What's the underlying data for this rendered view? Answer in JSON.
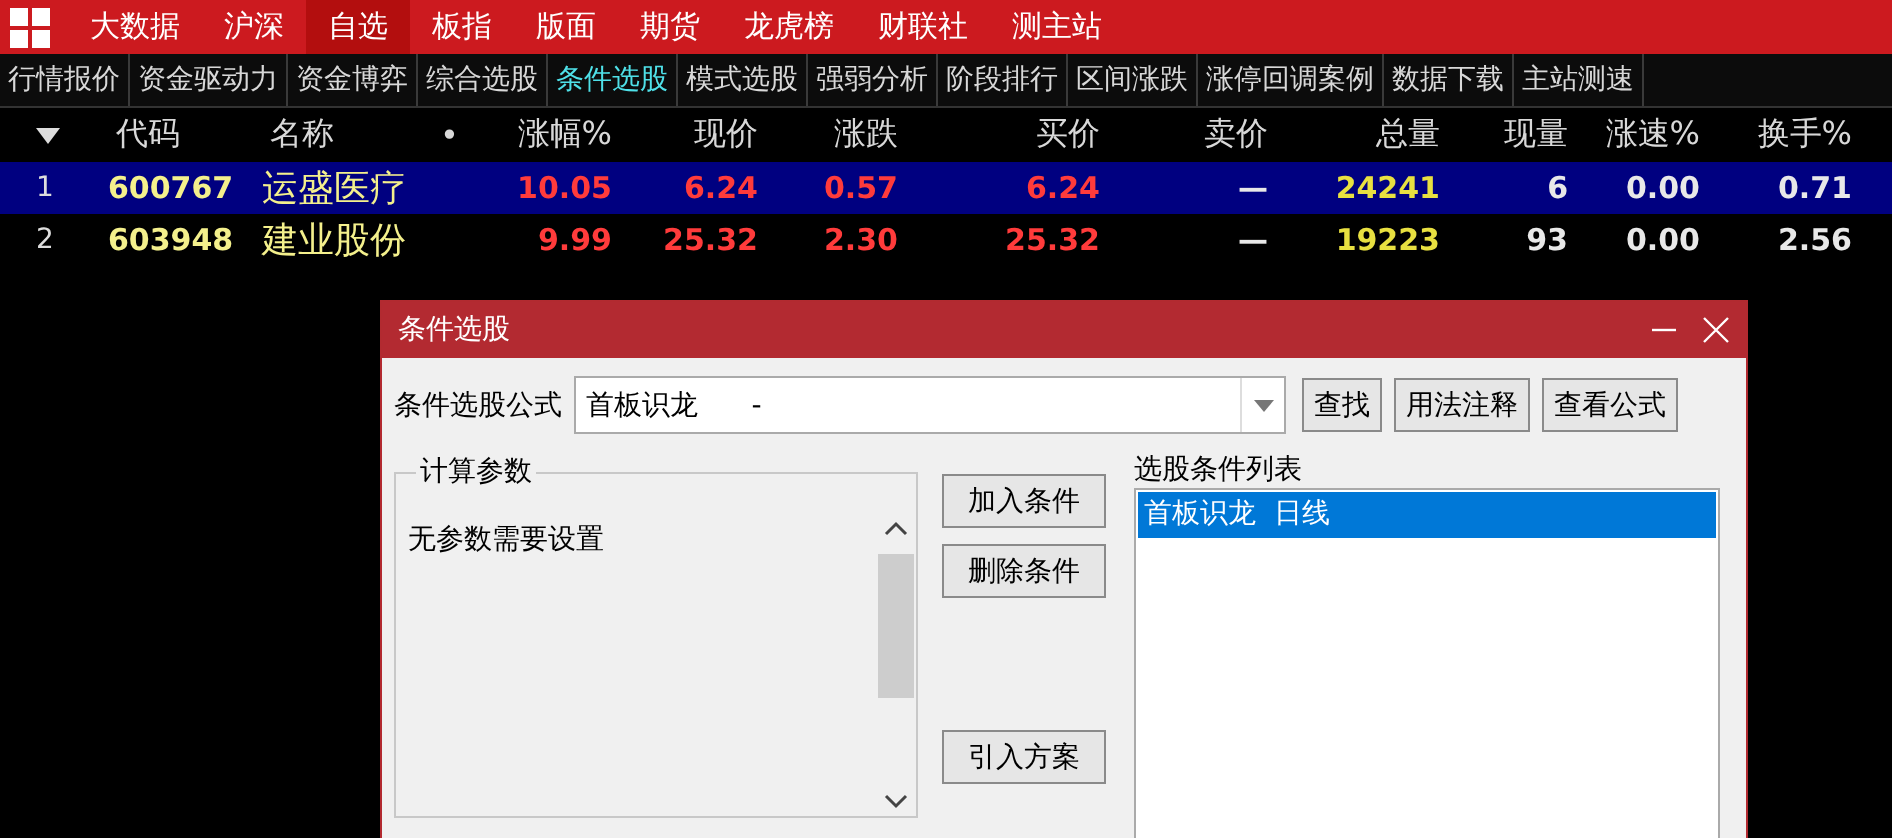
{
  "top_nav": [
    {
      "label": "大数据",
      "selected": false
    },
    {
      "label": "沪深",
      "selected": false
    },
    {
      "label": "自选",
      "selected": true
    },
    {
      "label": "板指",
      "selected": false
    },
    {
      "label": "版面",
      "selected": false
    },
    {
      "label": "期货",
      "selected": false
    },
    {
      "label": "龙虎榜",
      "selected": false
    },
    {
      "label": "财联社",
      "selected": false
    },
    {
      "label": "测主站",
      "selected": false
    }
  ],
  "sub_tabs": [
    {
      "label": "行情报价",
      "selected": false
    },
    {
      "label": "资金驱动力",
      "selected": false
    },
    {
      "label": "资金博弈",
      "selected": false
    },
    {
      "label": "综合选股",
      "selected": false
    },
    {
      "label": "条件选股",
      "selected": true
    },
    {
      "label": "模式选股",
      "selected": false
    },
    {
      "label": "强弱分析",
      "selected": false
    },
    {
      "label": "阶段排行",
      "selected": false
    },
    {
      "label": "区间涨跌",
      "selected": false
    },
    {
      "label": "涨停回调案例",
      "selected": false
    },
    {
      "label": "数据下载",
      "selected": false
    },
    {
      "label": "主站测速",
      "selected": false
    }
  ],
  "table": {
    "columns": [
      {
        "label": "代码",
        "kind": "code"
      },
      {
        "label": "名称",
        "kind": "name"
      },
      {
        "label": "•",
        "kind": "mark"
      },
      {
        "label": "涨幅%",
        "kind": "rise"
      },
      {
        "label": "现价",
        "kind": "rise"
      },
      {
        "label": "涨跌",
        "kind": "rise"
      },
      {
        "label": "买价",
        "kind": "rise"
      },
      {
        "label": "卖价",
        "kind": "plain"
      },
      {
        "label": "总量",
        "kind": "volume"
      },
      {
        "label": "现量",
        "kind": "plain"
      },
      {
        "label": "涨速%",
        "kind": "plain"
      },
      {
        "label": "换手%",
        "kind": "plain"
      }
    ],
    "rows": [
      {
        "index": "1",
        "selected": true,
        "cells": [
          "600767",
          "运盛医疗",
          "",
          "10.05",
          "6.24",
          "0.57",
          "6.24",
          "—",
          "24241",
          "6",
          "0.00",
          "0.71"
        ]
      },
      {
        "index": "2",
        "selected": false,
        "cells": [
          "603948",
          "建业股份",
          "",
          "9.99",
          "25.32",
          "2.30",
          "25.32",
          "—",
          "19223",
          "93",
          "0.00",
          "2.56"
        ]
      }
    ]
  },
  "dialog": {
    "title": "条件选股",
    "formula_label": "条件选股公式",
    "formula_value": "首板识龙      -",
    "top_buttons": [
      "查找",
      "用法注释",
      "查看公式"
    ],
    "params_title": "计算参数",
    "params_text": "无参数需要设置",
    "action_buttons": [
      "加入条件",
      "删除条件",
      "引入方案"
    ],
    "list_label": "选股条件列表",
    "list_items": [
      {
        "label": "首板识龙  日线",
        "selected": true
      }
    ]
  }
}
